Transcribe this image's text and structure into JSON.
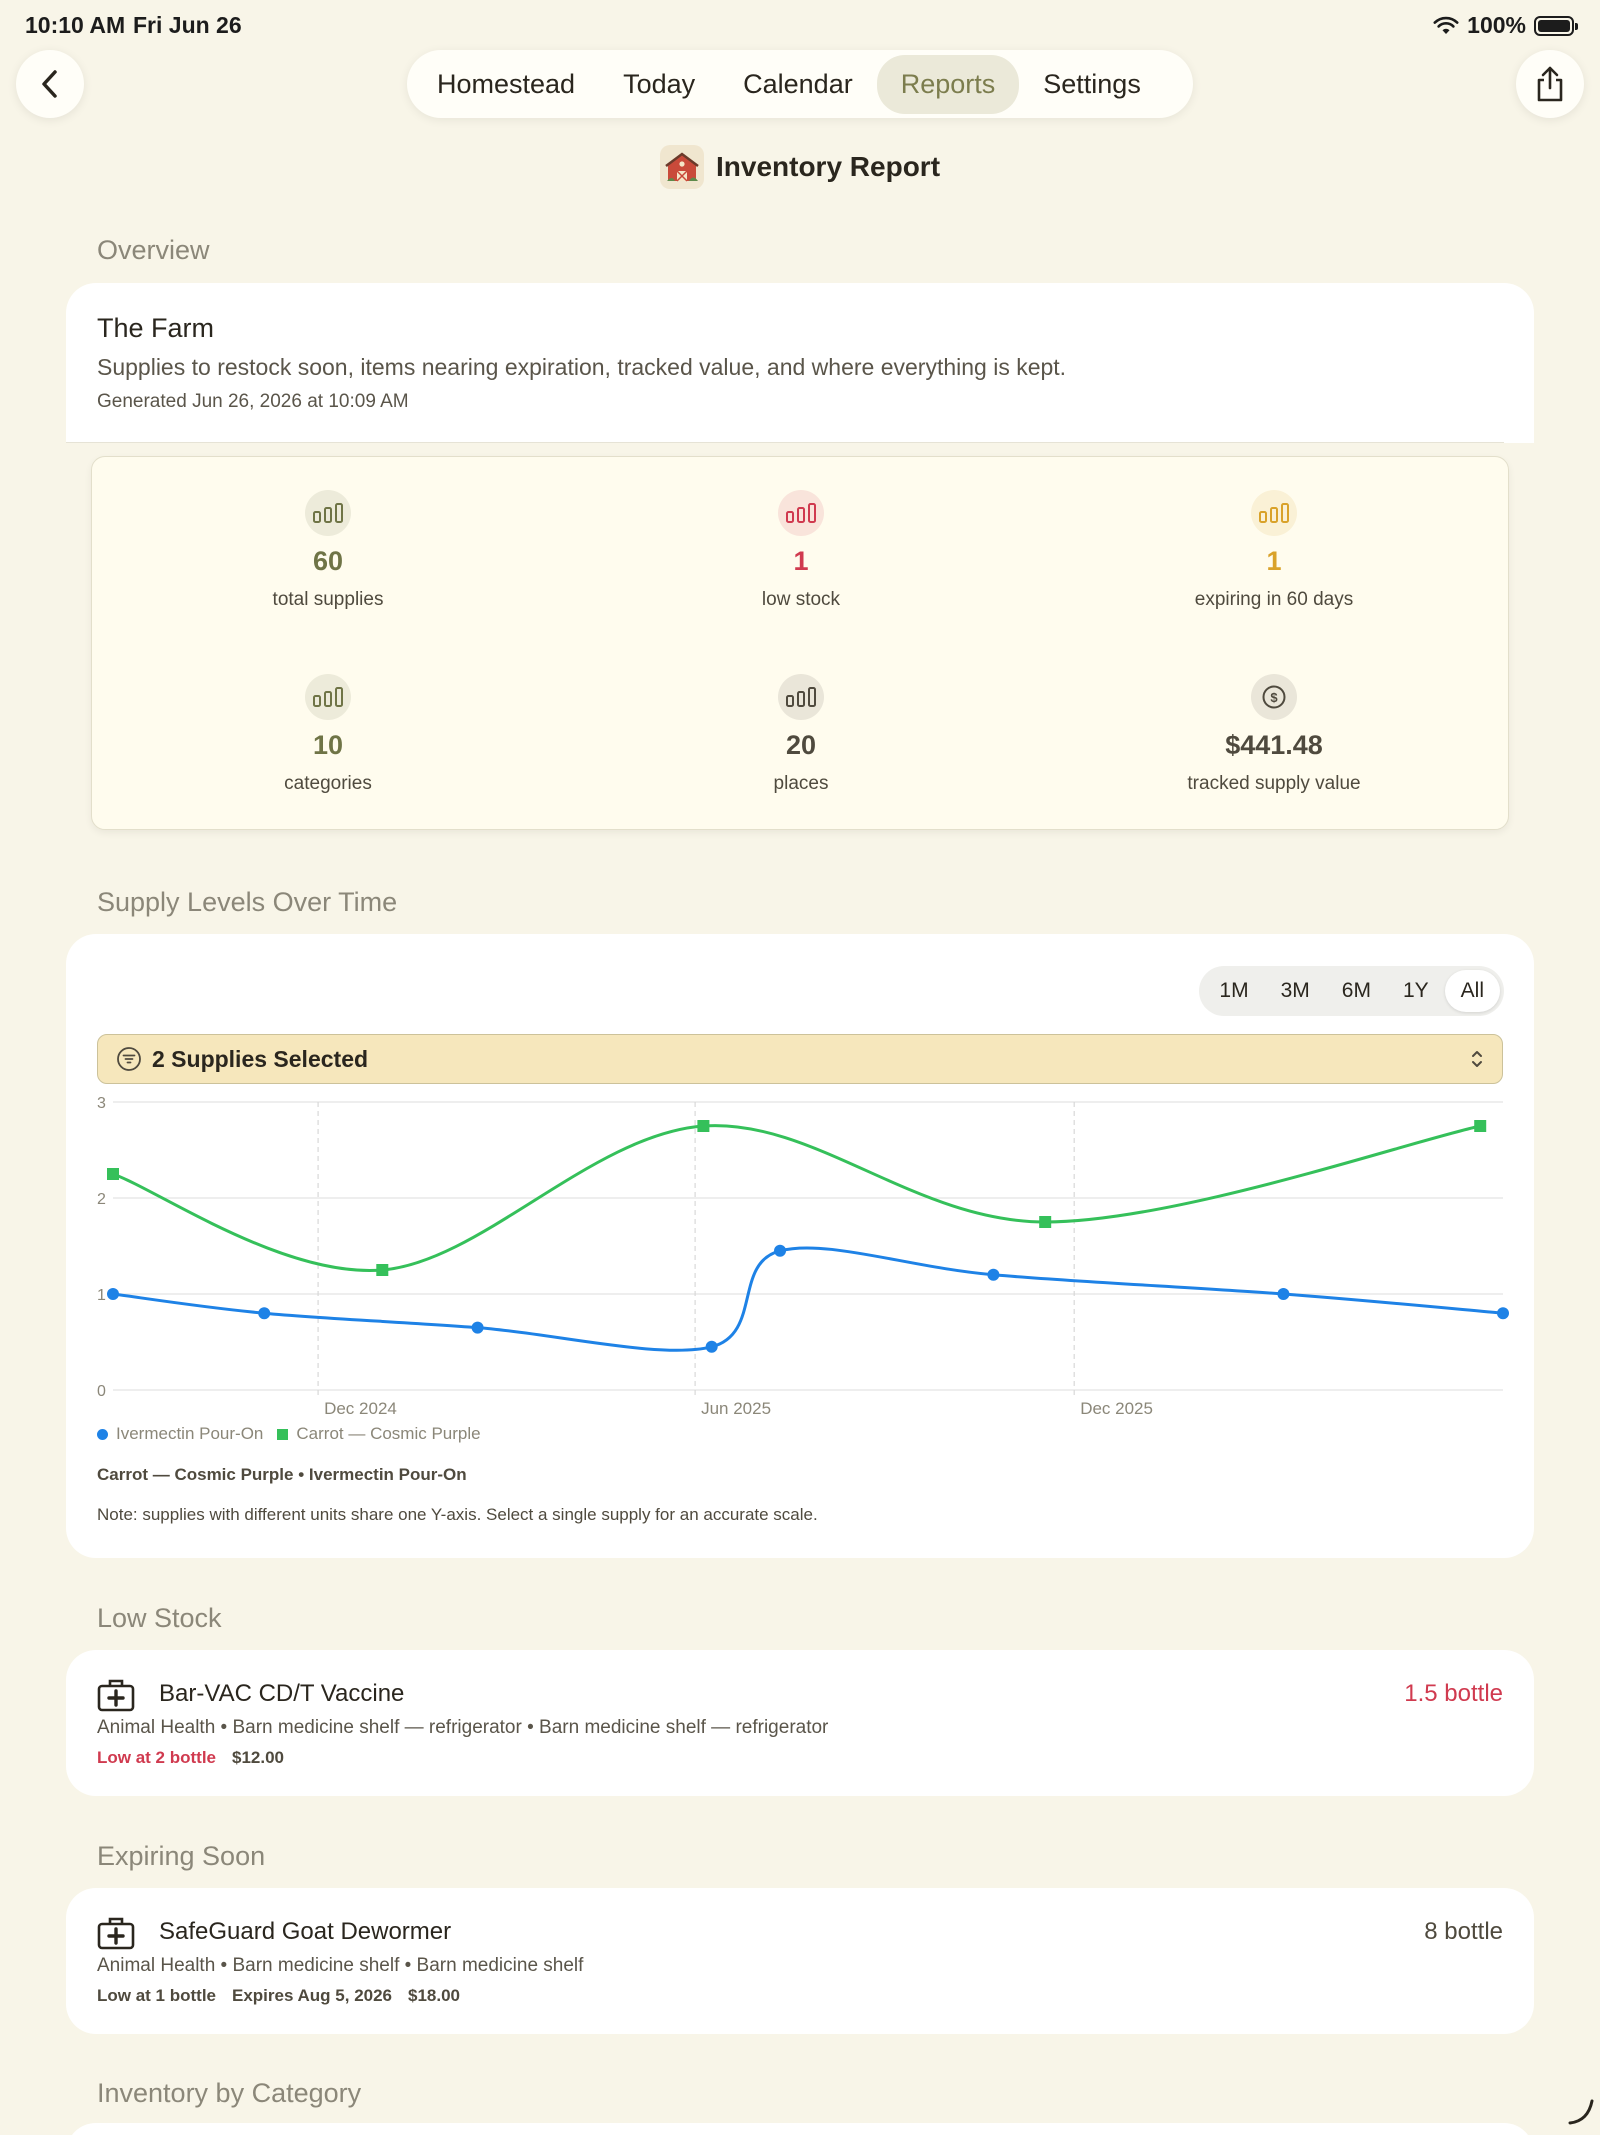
{
  "status": {
    "time": "10:10 AM",
    "date": "Fri Jun 26",
    "battery": "100%"
  },
  "tabs": [
    {
      "label": "Homestead"
    },
    {
      "label": "Today"
    },
    {
      "label": "Calendar"
    },
    {
      "label": "Reports",
      "active": true
    },
    {
      "label": "Settings"
    }
  ],
  "page": {
    "title": "Inventory Report"
  },
  "overview": {
    "section": "Overview",
    "title": "The Farm",
    "description": "Supplies to restock soon, items nearing expiration, tracked value, and where everything is kept.",
    "generated": "Generated Jun 26, 2026 at 10:09 AM"
  },
  "stats": [
    {
      "value": "60",
      "label": "total supplies",
      "color": "#6f7446",
      "icon": "bars-icon"
    },
    {
      "value": "1",
      "label": "low stock",
      "color": "#d03a4f",
      "icon": "bars-icon"
    },
    {
      "value": "1",
      "label": "expiring in 60 days",
      "color": "#d9a22a",
      "icon": "bars-icon"
    },
    {
      "value": "10",
      "label": "categories",
      "color": "#6f7446",
      "icon": "bars-icon"
    },
    {
      "value": "20",
      "label": "places",
      "color": "#4f4a3e",
      "icon": "bars-icon"
    },
    {
      "value": "$441.48",
      "label": "tracked supply value",
      "color": "#4f4a3e",
      "icon": "dollar-icon"
    }
  ],
  "supply_chart": {
    "section": "Supply Levels Over Time",
    "ranges": [
      "1M",
      "3M",
      "6M",
      "1Y",
      "All"
    ],
    "active_range": "All",
    "selector": "2 Supplies Selected",
    "selection_summary": "Carrot — Cosmic Purple • Ivermectin Pour-On",
    "note": "Note: supplies with different units share one Y-axis. Select a single supply for an accurate scale."
  },
  "chart_data": {
    "type": "line",
    "x_ticks": [
      "Dec 2024",
      "Jun 2025",
      "Dec 2025"
    ],
    "y_ticks": [
      "0",
      "1",
      "2",
      "3"
    ],
    "ylim": [
      0,
      3
    ],
    "grid": true,
    "legend": "bottom-left",
    "series": [
      {
        "name": "Ivermectin Pour-On",
        "color": "#1e82e6",
        "marker": "circle",
        "x": [
          "2024-08-24",
          "2024-11-05",
          "2025-02-16",
          "2025-06-09",
          "2025-07-12",
          "2025-10-23",
          "2026-03-12",
          "2026-06-26"
        ],
        "y": [
          1.0,
          0.8,
          0.65,
          0.45,
          1.45,
          1.2,
          1.0,
          0.8
        ]
      },
      {
        "name": "Carrot — Cosmic Purple",
        "color": "#35c05a",
        "marker": "square",
        "x": [
          "2024-08-24",
          "2025-01-01",
          "2025-06-05",
          "2025-11-17",
          "2026-06-15"
        ],
        "y": [
          2.25,
          1.25,
          2.75,
          1.75,
          2.75
        ]
      }
    ]
  },
  "low_stock": {
    "section": "Low Stock",
    "item": {
      "name": "Bar-VAC CD/T Vaccine",
      "qty": "1.5 bottle",
      "qty_color": "#d03a4f",
      "path": "Animal Health • Barn medicine shelf — refrigerator • Barn medicine shelf — refrigerator",
      "threshold": "Low at 2 bottle",
      "threshold_color": "#d03a4f",
      "price": "$12.00"
    }
  },
  "expiring": {
    "section": "Expiring Soon",
    "item": {
      "name": "SafeGuard Goat Dewormer",
      "qty": "8 bottle",
      "qty_color": "#4f4a3e",
      "path": "Animal Health • Barn medicine shelf • Barn medicine shelf",
      "threshold": "Low at 1 bottle",
      "expires": "Expires Aug 5, 2026",
      "price": "$18.00"
    }
  },
  "category_section": "Inventory by Category"
}
